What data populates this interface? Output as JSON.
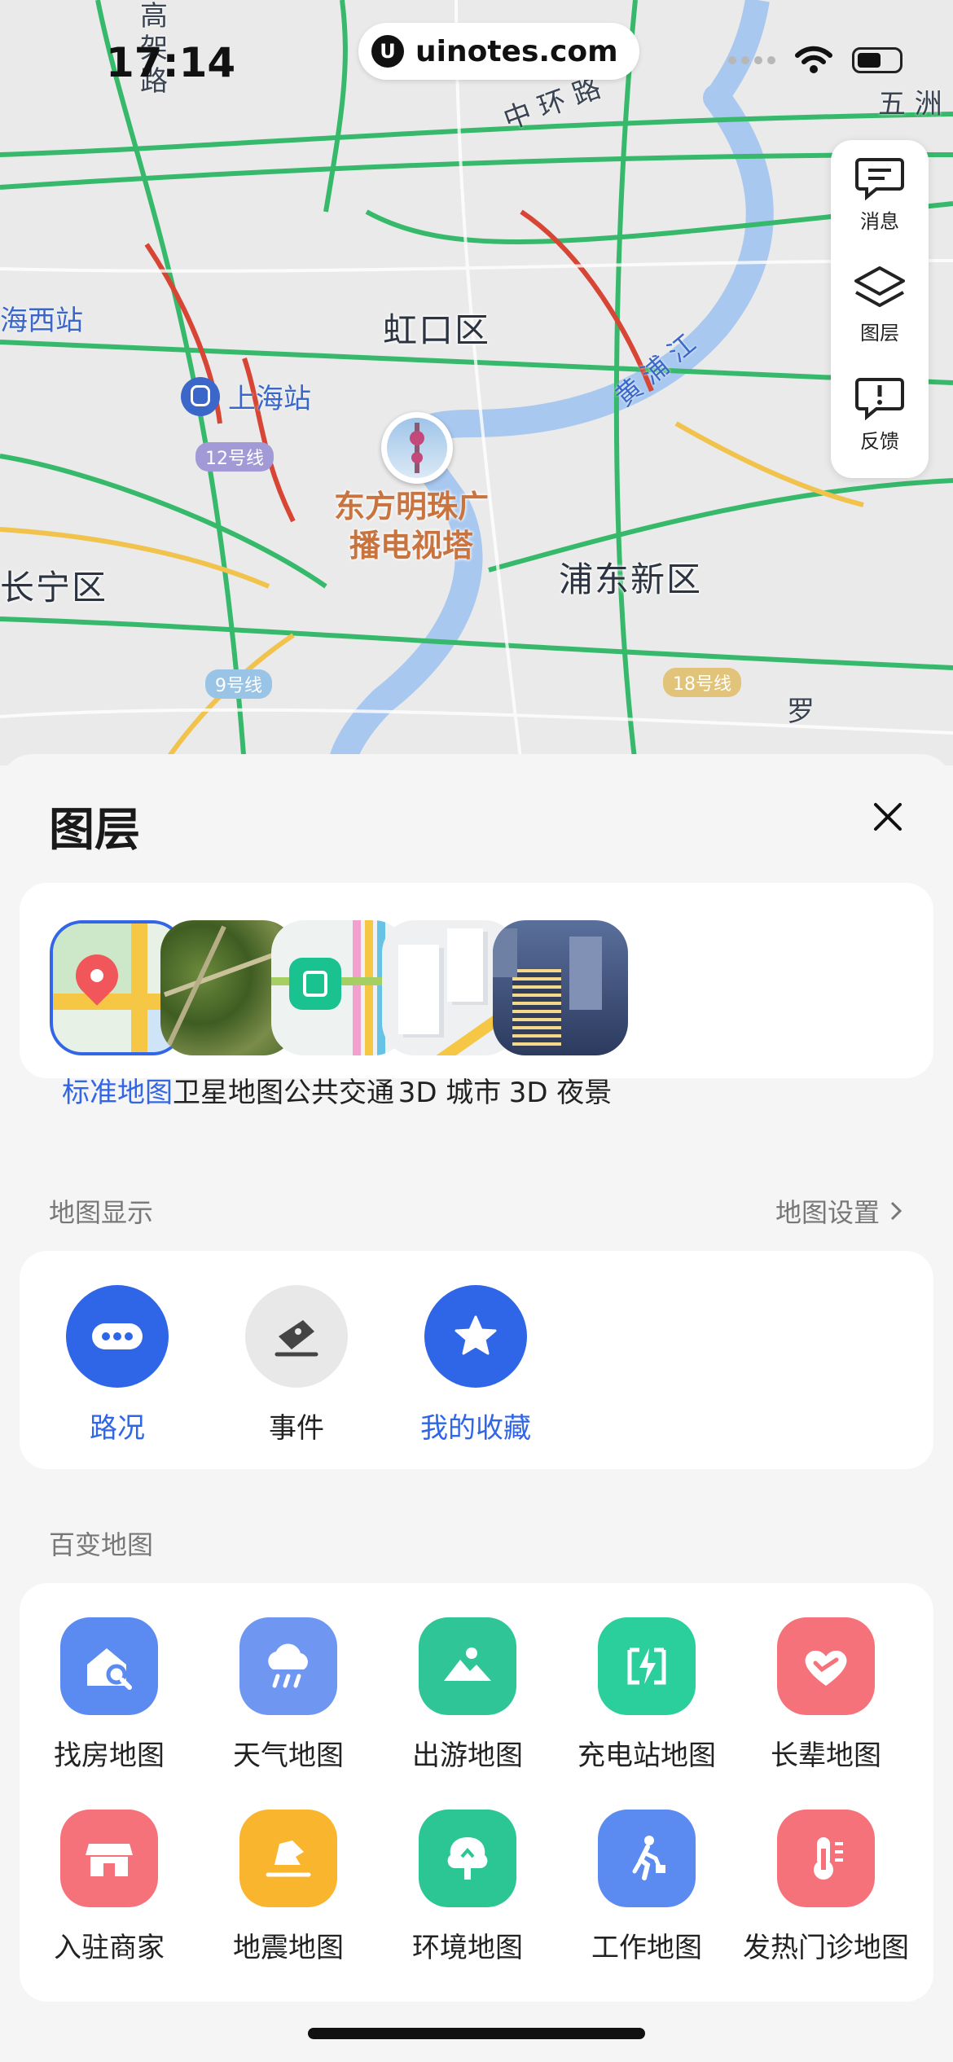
{
  "status_bar": {
    "time": "17:14",
    "watermark": "uinotes.com"
  },
  "map": {
    "districts": [
      "虹口区",
      "浦东新区",
      "长宁区"
    ],
    "stations": [
      "上海站",
      "海西站"
    ],
    "roads": [
      "中 环 路",
      "黄 浦 江",
      "五 洲",
      "高 架 路",
      "罗"
    ],
    "metro_lines": [
      "12号线",
      "9号线",
      "18号线"
    ],
    "poi": {
      "line1": "东方明珠广",
      "line2": "播电视塔"
    }
  },
  "side_panel": {
    "items": [
      {
        "label": "消息",
        "icon": "message-icon"
      },
      {
        "label": "图层",
        "icon": "layers-icon"
      },
      {
        "label": "反馈",
        "icon": "feedback-icon"
      }
    ]
  },
  "sheet": {
    "title": "图层",
    "layer_types": [
      {
        "label": "标准地图",
        "selected": true
      },
      {
        "label": "卫星地图",
        "selected": false
      },
      {
        "label": "公共交通",
        "selected": false
      },
      {
        "label": "3D 城市",
        "selected": false
      },
      {
        "label": "3D 夜景",
        "selected": false
      }
    ],
    "map_display": {
      "label": "地图显示",
      "settings_link": "地图设置",
      "items": [
        {
          "label": "路况",
          "active": true
        },
        {
          "label": "事件",
          "active": false
        },
        {
          "label": "我的收藏",
          "active": true
        }
      ]
    },
    "theme_maps": {
      "label": "百变地图",
      "items": [
        {
          "label": "找房地图",
          "icon": "house-search-icon",
          "color": "#5b8bf0"
        },
        {
          "label": "天气地图",
          "icon": "weather-icon",
          "color": "#6f97f2"
        },
        {
          "label": "出游地图",
          "icon": "mountain-icon",
          "color": "#2fc597"
        },
        {
          "label": "充电站地图",
          "icon": "charging-icon",
          "color": "#2bcf9c"
        },
        {
          "label": "长辈地图",
          "icon": "heart-icon",
          "color": "#f5727a"
        },
        {
          "label": "入驻商家",
          "icon": "store-icon",
          "color": "#f5727a"
        },
        {
          "label": "地震地图",
          "icon": "earthquake-icon",
          "color": "#f9b52d"
        },
        {
          "label": "环境地图",
          "icon": "tree-icon",
          "color": "#2bc693"
        },
        {
          "label": "工作地图",
          "icon": "worker-icon",
          "color": "#5b8bf0"
        },
        {
          "label": "发热门诊地图",
          "icon": "thermometer-icon",
          "color": "#f5727a"
        }
      ]
    }
  },
  "colors": {
    "accent": "#3366e6",
    "active_blue": "#2f66e8"
  }
}
